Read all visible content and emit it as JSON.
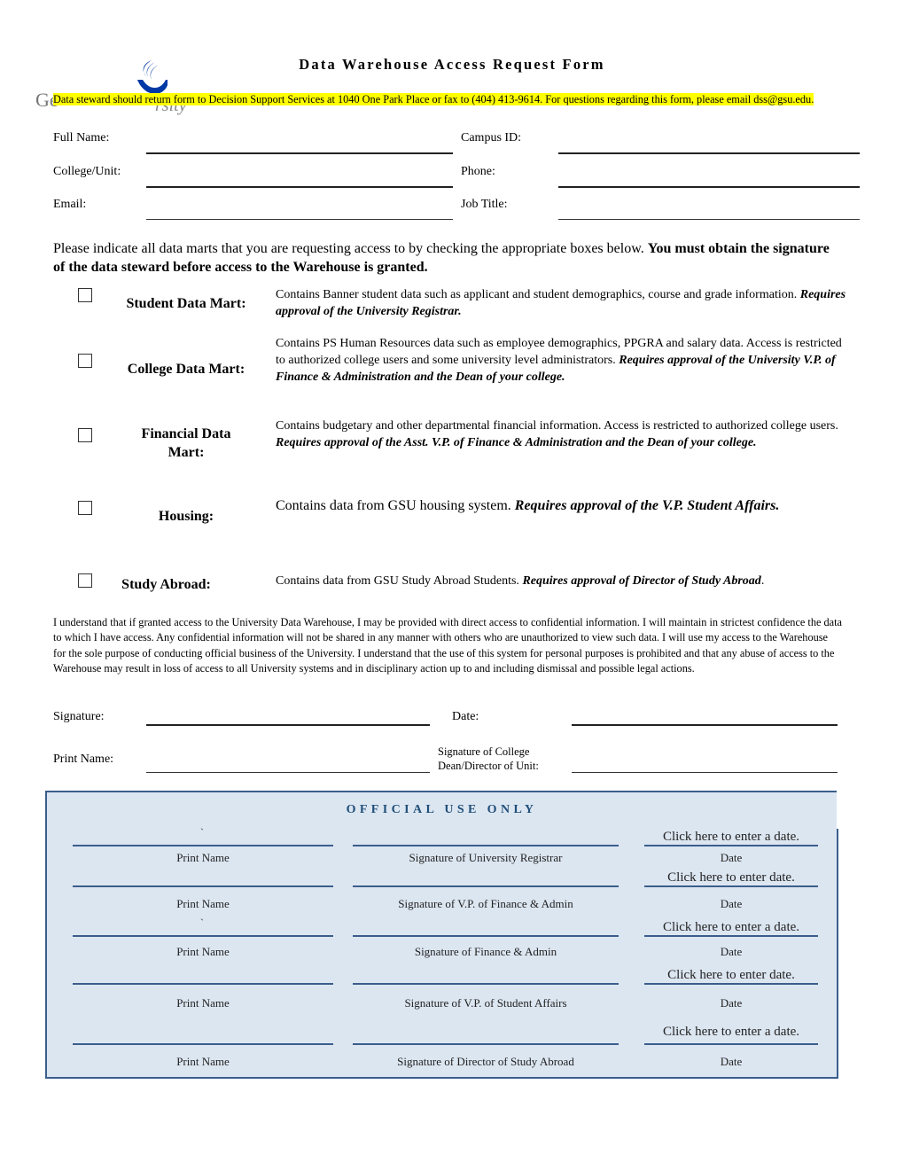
{
  "header": {
    "title": "Data Warehouse Access Request Form",
    "logo_text": "Georgia State University",
    "notice": "Data steward should return form to Decision Support Services at 1040 One Park Place or fax to (404) 413-9614.  For questions regarding this form, please email dss@gsu.edu."
  },
  "personal_fields": {
    "full_name_label": "Full Name:",
    "campus_id_label": "Campus ID:",
    "college_unit_label": "College/Unit:",
    "phone_label": "Phone:",
    "email_label": "Email:",
    "job_title_label": "Job Title:"
  },
  "instructions": {
    "normal": "Please indicate all data marts that you are requesting access to by checking the appropriate boxes below. ",
    "bold": "You must obtain the signature of the data steward before access to the Warehouse is granted."
  },
  "data_marts": [
    {
      "name": "Student Data Mart:",
      "description": "Contains Banner student data such as applicant and student demographics, course and grade information. ",
      "approval": "Requires approval of the University Registrar.",
      "checked": false
    },
    {
      "name": "College Data Mart:",
      "description": "Contains PS Human Resources data such as employee demographics, PPGRA and salary data. Access is restricted to authorized college users and some university level administrators. ",
      "approval": "Requires approval of the University V.P. of Finance & Administration and the Dean of your college.",
      "checked": false
    },
    {
      "name": "Financial Data Mart:",
      "description": "Contains budgetary and other departmental financial information. Access is restricted to authorized college users. ",
      "approval": "Requires approval of the Asst. V.P. of Finance & Administration and the Dean of your college.",
      "checked": false
    },
    {
      "name": "Housing:",
      "description": "Contains data from GSU housing system.  ",
      "approval": "Requires approval of the V.P. Student Affairs.",
      "checked": false
    },
    {
      "name": "Study Abroad:",
      "description": "Contains data from GSU Study Abroad Students. ",
      "approval": "Requires approval of Director of Study Abroad",
      "approval_suffix": ".",
      "checked": false
    }
  ],
  "agreement": "I understand that if granted access to the University Data Warehouse, I may be provided with direct access to confidential information.  I will maintain in strictest confidence the data to which I have access. Any confidential information will not be shared in any manner with others who are unauthorized to view such data. I will use my access to the Warehouse for the sole purpose of conducting official business of the University. I understand that the use of this system for personal purposes is prohibited and that any abuse of access to the Warehouse may result in loss of access to all University systems and in disciplinary action up to and including dismissal and possible legal actions.",
  "signatures": {
    "signature_label": "Signature:",
    "date_label": "Date:",
    "print_name_label": "Print Name:",
    "dean_label_line1": "Signature of College",
    "dean_label_line2": "Dean/Director of Unit:"
  },
  "official_use": {
    "title": "OFFICIAL USE ONLY",
    "tick_mark": "`",
    "rows": [
      {
        "print_name": "Print Name",
        "signature": "Signature of University Registrar",
        "date_caption": "Date",
        "date_value": "Click here to enter a date.",
        "tick": true
      },
      {
        "print_name": "Print Name",
        "signature": "Signature of V.P. of Finance & Admin",
        "date_caption": "Date",
        "date_value": "Click here to enter date.",
        "tick": false
      },
      {
        "print_name": "Print Name",
        "signature": "Signature of Finance & Admin",
        "date_caption": "Date",
        "date_value": "Click here to enter a date.",
        "tick": true
      },
      {
        "print_name": "Print Name",
        "signature": "Signature of V.P. of Student Affairs",
        "date_caption": "Date",
        "date_value": "Click here to enter date.",
        "tick": false
      },
      {
        "print_name": "Print Name",
        "signature": "Signature of Director of Study Abroad",
        "date_caption": "Date",
        "date_value": "Click here to enter a date.",
        "tick": false
      }
    ]
  },
  "colors": {
    "highlight": "#ffff00",
    "official_bg": "#dce6f1",
    "official_border": "#3b5e8c",
    "official_title": "#1f4e79",
    "logo_blue": "#0039a6"
  }
}
